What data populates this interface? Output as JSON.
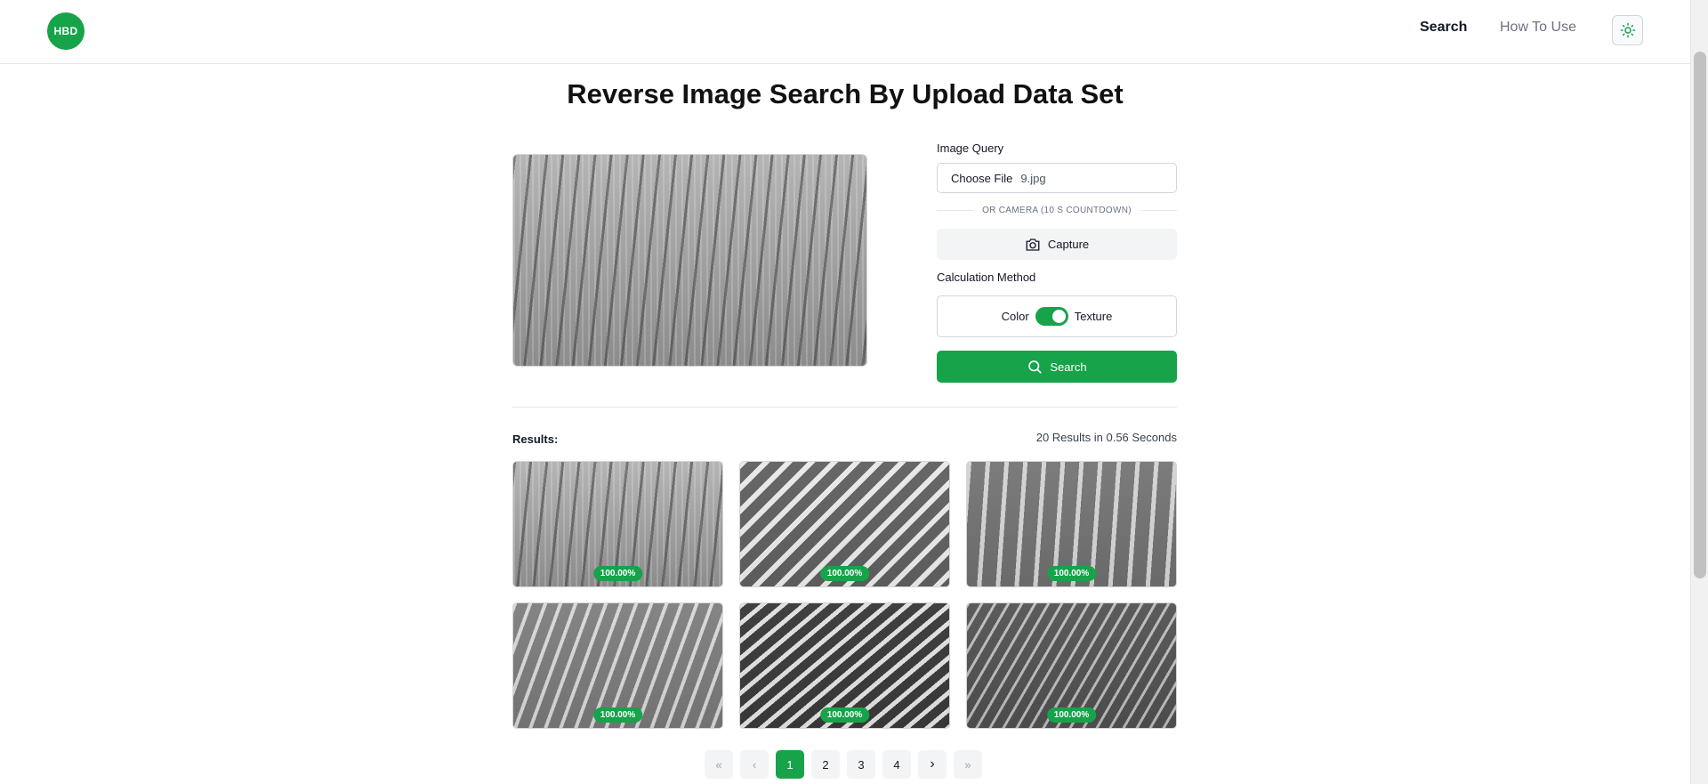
{
  "header": {
    "logo": "HBD",
    "nav": {
      "search": "Search",
      "how_to_use": "How To Use"
    }
  },
  "page": {
    "title": "Reverse Image Search By Upload Data Set"
  },
  "form": {
    "image_query_label": "Image Query",
    "file_button": "Choose File",
    "file_name": "9.jpg",
    "divider": "OR CAMERA (10 S COUNTDOWN)",
    "capture_label": "Capture",
    "calculation_label": "Calculation Method",
    "method_left": "Color",
    "method_right": "Texture",
    "method_toggle_on": true,
    "search_label": "Search"
  },
  "results": {
    "label": "Results:",
    "stats": "20 Results in 0.56 Seconds",
    "items": [
      {
        "score": "100.00%"
      },
      {
        "score": "100.00%"
      },
      {
        "score": "100.00%"
      },
      {
        "score": "100.00%"
      },
      {
        "score": "100.00%"
      },
      {
        "score": "100.00%"
      }
    ]
  },
  "pagination": {
    "first": "«",
    "prev": "‹",
    "pages": [
      "1",
      "2",
      "3",
      "4"
    ],
    "current": "1",
    "next": "›",
    "last": "»"
  },
  "colors": {
    "accent": "#16a34a"
  }
}
